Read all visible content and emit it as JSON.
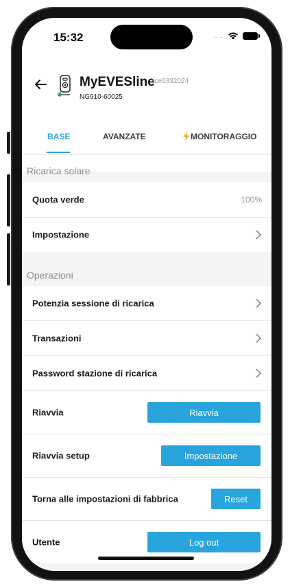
{
  "status_bar": {
    "time": "15:32",
    "signal_dots": "....",
    "wifi_icon": "wifi-icon",
    "battery_icon": "battery-icon"
  },
  "header": {
    "back_icon": "arrow-left-icon",
    "device_icon": "charger-icon",
    "device_status_color": "#2fa84f",
    "title": "MyEVESline",
    "tag": "ace0332024",
    "serial": "NG910-60025"
  },
  "tabs": [
    {
      "label": "BASE",
      "active": true
    },
    {
      "label": "AVANZATE",
      "active": false
    },
    {
      "label": "MONITORAGGIO",
      "icon": "lightning-icon",
      "active": false
    }
  ],
  "solar": {
    "section_title": "Ricarica solare",
    "quota_label": "Quota verde",
    "quota_value": "100%",
    "impostazione_label": "Impostazione"
  },
  "operations": {
    "section_title": "Operazioni",
    "power_label": "Potenzia sessione di ricarica",
    "transactions_label": "Transazioni",
    "password_label": "Password stazione di ricarica",
    "restart_label": "Riavvia",
    "restart_button": "Riavvia",
    "restart_setup_label": "Riavvia setup",
    "restart_setup_button": "Impostazione",
    "factory_label": "Torna alle impostazioni di fabbrica",
    "factory_button": "Reset",
    "user_label": "Utente",
    "user_button": "Log out"
  },
  "colors": {
    "accent": "#29a4dc",
    "lightning": "#f5a623",
    "background": "#f4f4f4"
  }
}
